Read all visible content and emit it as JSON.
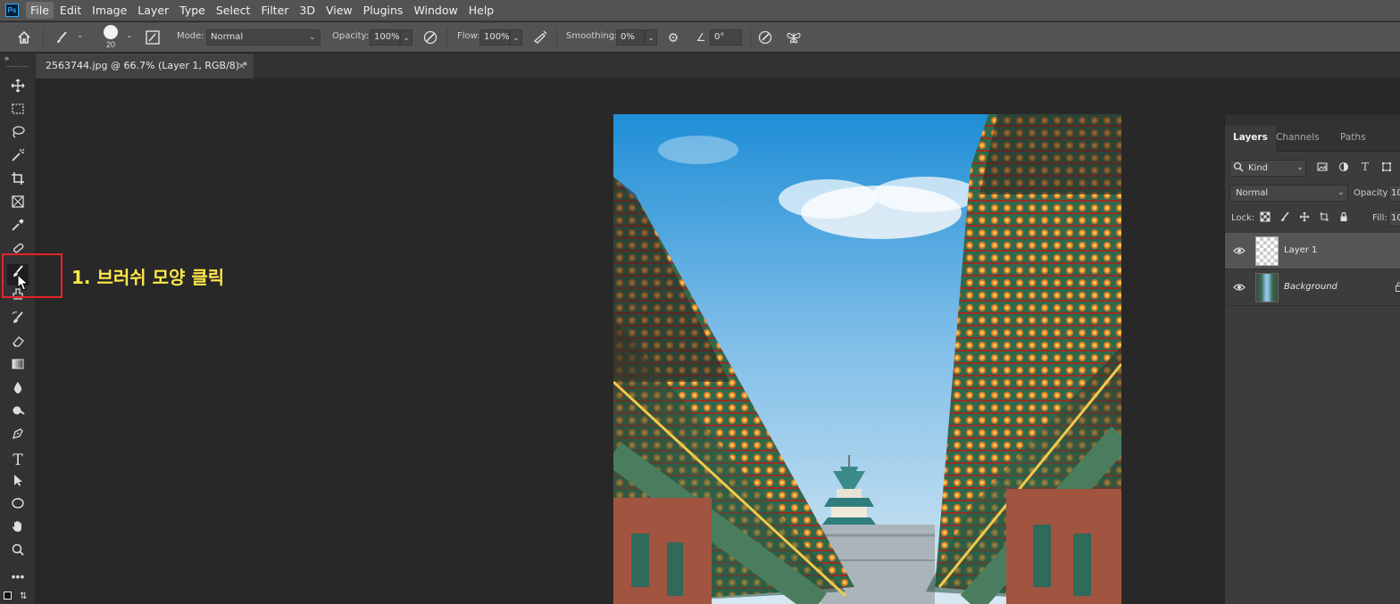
{
  "app": {
    "logo": "Ps"
  },
  "menu": {
    "items": [
      "File",
      "Edit",
      "Image",
      "Layer",
      "Type",
      "Select",
      "Filter",
      "3D",
      "View",
      "Plugins",
      "Window",
      "Help"
    ],
    "active": "File"
  },
  "options": {
    "brush_size": "20",
    "mode_label": "Mode:",
    "mode_value": "Normal",
    "opacity_label": "Opacity:",
    "opacity_value": "100%",
    "flow_label": "Flow:",
    "flow_value": "100%",
    "smoothing_label": "Smoothing:",
    "smoothing_value": "0%",
    "angle_value": "0°"
  },
  "document": {
    "tab_title": "2563744.jpg @ 66.7% (Layer 1, RGB/8) *",
    "close_glyph": "×"
  },
  "annotation": {
    "text": "1. 브러쉬 모양 클릭",
    "color": "#ffe84a",
    "box_color": "#e3242b"
  },
  "tools": [
    "move",
    "marquee",
    "lasso",
    "magic-wand",
    "crop",
    "frame",
    "eyedropper",
    "healing",
    "brush",
    "stamp",
    "history-brush",
    "eraser",
    "gradient",
    "blur",
    "dodge",
    "pen",
    "type",
    "path-select",
    "ellipse",
    "hand",
    "zoom",
    "more"
  ],
  "layers_panel": {
    "tabs": [
      "Layers",
      "Channels",
      "Paths"
    ],
    "active_tab": "Layers",
    "filter_label": "Kind",
    "blend_mode": "Normal",
    "opacity_label": "Opacity:",
    "opacity_value": "10",
    "lock_label": "Lock:",
    "fill_label": "Fill:",
    "fill_value": "10",
    "layers": [
      {
        "name": "Layer 1",
        "selected": true,
        "italic": false
      },
      {
        "name": "Background",
        "selected": false,
        "italic": true
      }
    ]
  }
}
